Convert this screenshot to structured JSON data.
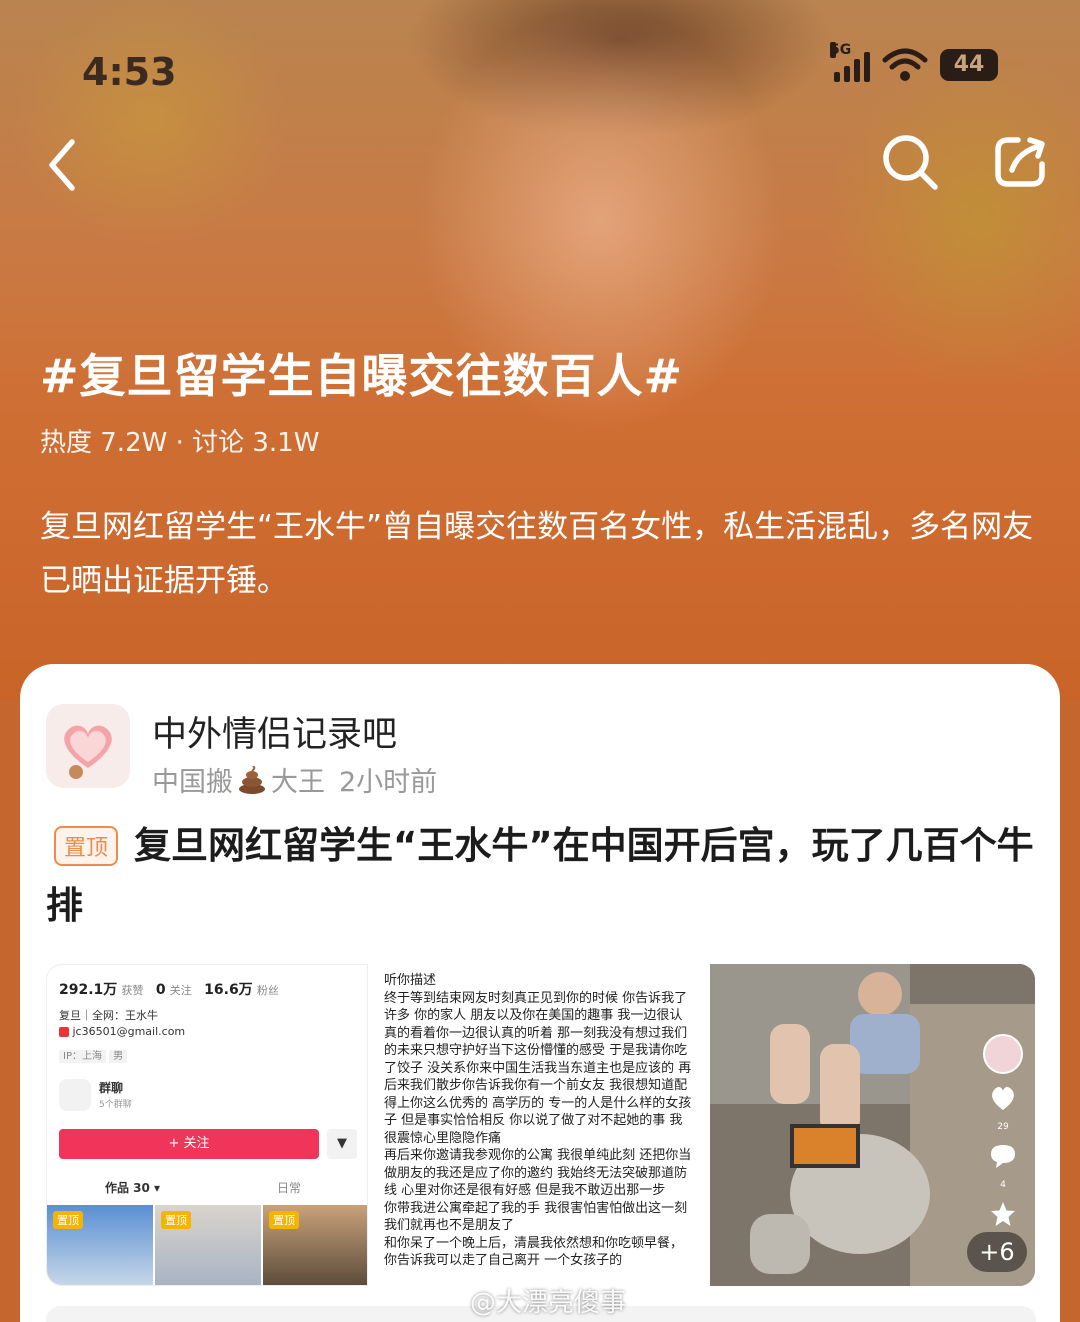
{
  "status_bar": {
    "time": "4:53",
    "network": "5G",
    "battery": "44"
  },
  "nav": {
    "back_icon": "chevron-left-icon",
    "search_icon": "search-icon",
    "share_icon": "share-icon"
  },
  "topic": {
    "title": "#复旦留学生自曝交往数百人#",
    "stats": "热度 7.2W · 讨论 3.1W",
    "description": "复旦网红留学生“王水牛”曾自曝交往数百名女性，私生活混乱，多名网友已晒出证据开锤。"
  },
  "post": {
    "forum_name": "中外情侣记录吧",
    "author_prefix": "中国搬",
    "author_suffix": "大王",
    "time_ago": "2小时前",
    "pin_label": "置顶",
    "title": "复旦网红留学生“王水牛”在中国开后宫，玩了几百个牛排",
    "images": {
      "profile": {
        "likes": "292.1万",
        "likes_label": "获赞",
        "following": "0",
        "following_label": "关注",
        "fans": "16.6万",
        "fans_label": "粉丝",
        "bio": "复旦｜全网：王水牛",
        "email": "jc36501@gmail.com",
        "ip": "IP：上海",
        "gender": "男",
        "group_name": "群聊",
        "group_count": "5个群聊",
        "follow_button": "+ 关注",
        "tab_works": "作品 30 ▾",
        "tab_daily": "日常",
        "pin_tags": [
          "置顶",
          "置顶",
          "置顶"
        ]
      },
      "note_text": "听你描述\n终于等到结束网友时刻真正见到你的时候 你告诉我了许多 你的家人 朋友以及你在美国的趣事 我一边很认真的看着你一边很认真的听着 那一刻我没有想过我们的未来只想守护好当下这份懵懂的感受 于是我请你吃了饺子 没关系你来中国生活我当东道主也是应该的 再后来我们散步你告诉我你有一个前女友 我很想知道配得上你这么优秀的 高学历的 专一的人是什么样的女孩子 但是事实恰恰相反 你以说了做了对不起她的事 我很震惊心里隐隐作痛\n 再后来你邀请我参观你的公寓 我很单纯此刻 还把你当做朋友的我还是应了你的邀约 我始终无法突破那道防线 心里对你还是很有好感 但是我不敢迈出那一步\n 你带我进公寓牵起了我的手 我很害怕害怕做出这一刻我们就再也不是朋友了\n和你呆了一个晚上后，清晨我依然想和你吃顿早餐，你告诉我可以走了自己离开 一个女孩子的",
      "video_side": {
        "like_count": "29",
        "comment_count": "4",
        "more_count": "+6"
      }
    }
  },
  "watermark": "@大漂亮傻事",
  "colors": {
    "hero_orange": "#c96429",
    "pin_orange": "#f08a4b",
    "follow_red": "#f0345a"
  }
}
